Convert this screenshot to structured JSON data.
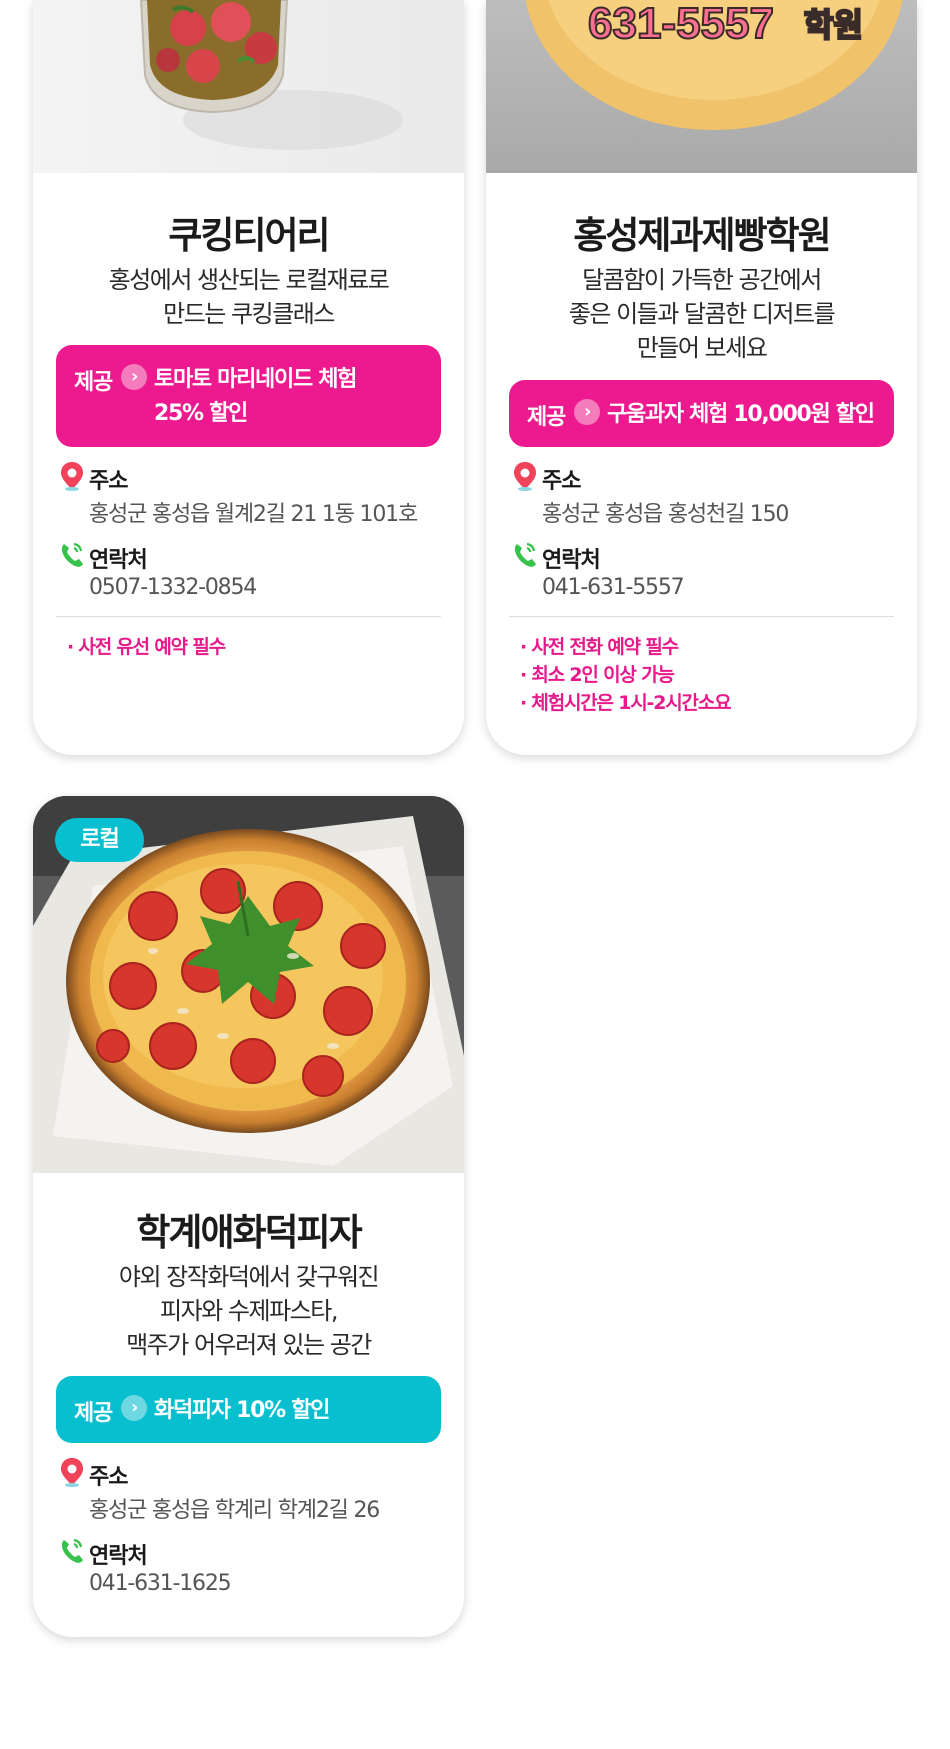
{
  "cards": [
    {
      "title": "쿠킹티어리",
      "description": [
        "홍성에서 생산되는 로컬재료로",
        "만드는 쿠킹클래스"
      ],
      "offer": {
        "label": "제공",
        "lines": [
          "토마토 마리네이드 체험",
          "25% 할인"
        ],
        "color": "#ec1a8e"
      },
      "address_label": "주소",
      "address": "홍성군 홍성읍 월계2길 21 1동 101호",
      "contact_label": "연락처",
      "contact": "0507-1332-0854",
      "notes": [
        "· 사전 유선 예약 필수"
      ]
    },
    {
      "title": "홍성제과제빵학원",
      "photo_text": {
        "number": "631-5557",
        "suffix": "학원"
      },
      "description": [
        "달콤함이 가득한 공간에서",
        "좋은 이들과 달콤한 디저트를",
        "만들어 보세요"
      ],
      "offer": {
        "label": "제공",
        "lines": [
          "구움과자 체험 10,000원 할인"
        ],
        "color": "#ec1a8e"
      },
      "address_label": "주소",
      "address": "홍성군 홍성읍 홍성천길 150",
      "contact_label": "연락처",
      "contact": "041-631-5557",
      "notes": [
        "· 사전 전화 예약 필수",
        "· 최소 2인 이상 가능",
        "· 체험시간은 1시-2시간소요"
      ]
    },
    {
      "badge": "로컬",
      "title": "학계애화덕피자",
      "description": [
        "야외 장작화덕에서 갖구워진",
        "피자와 수제파스타,",
        "맥주가 어우러져 있는 공간"
      ],
      "offer": {
        "label": "제공",
        "lines": [
          "화덕피자 10% 할인"
        ],
        "color": "#07bfcf"
      },
      "address_label": "주소",
      "address": "홍성군 홍성읍 학계리 학계2길 26",
      "contact_label": "연락처",
      "contact": "041-631-1625"
    }
  ],
  "icons": {
    "location": "location-pin-icon",
    "phone": "phone-icon",
    "arrow": "chevron-right-icon"
  },
  "colors": {
    "pink": "#ec1a8e",
    "cyan": "#07bfcf",
    "pin_red": "#f0435a",
    "phone_green": "#37c24c"
  }
}
